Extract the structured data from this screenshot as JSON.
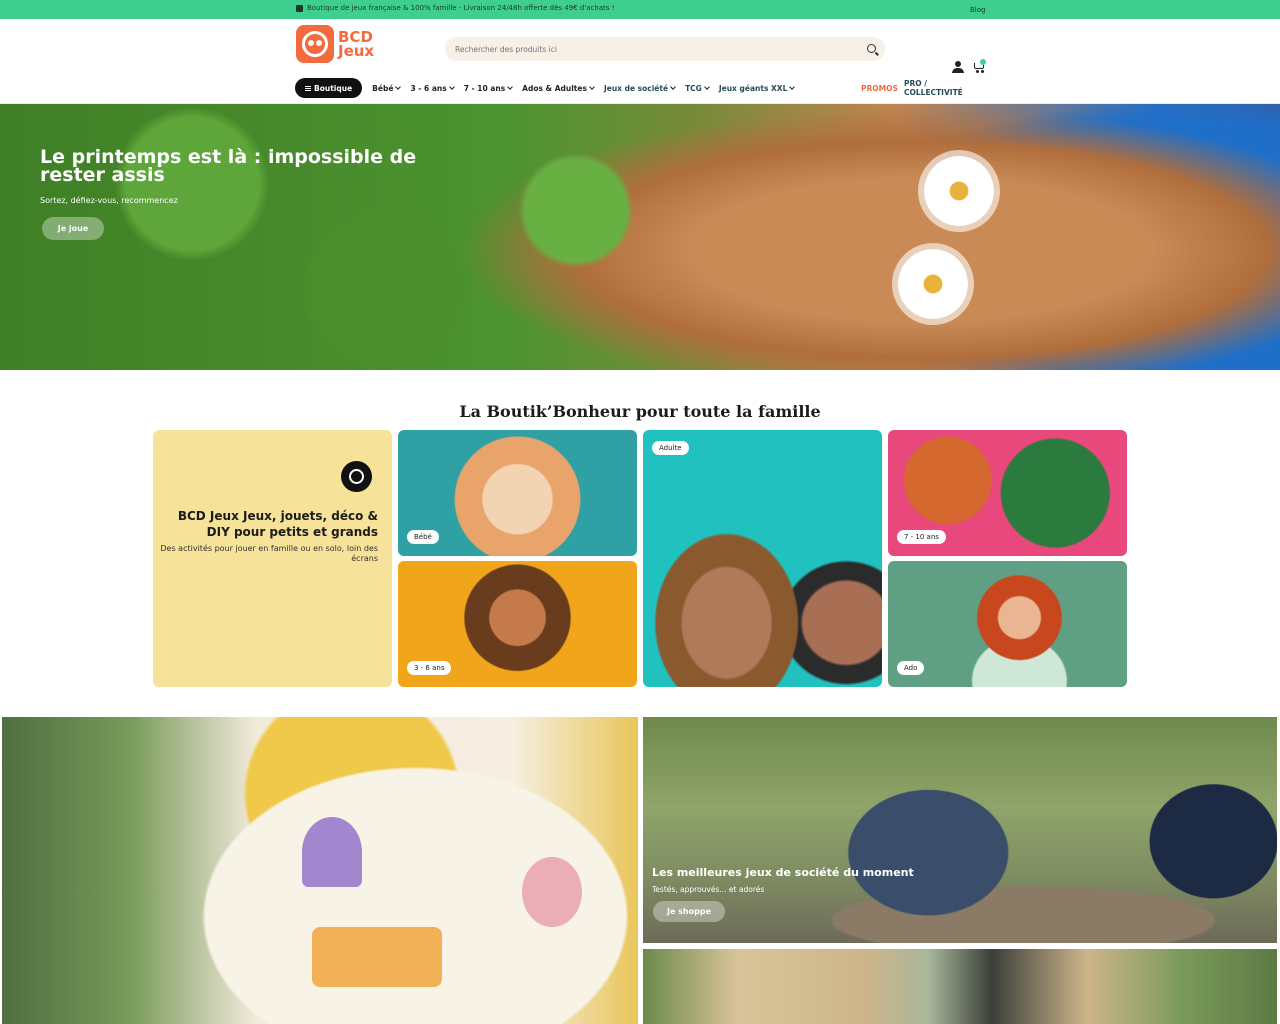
{
  "topbar": {
    "message": "Boutique de jeux française & 100% famille - Livraison 24/48h offerte dès 49€ d'achats !",
    "blog": "Blog"
  },
  "header": {
    "logo_line1": "BCD",
    "logo_line2": "Jeux",
    "search_placeholder": "Rechercher des produits ici"
  },
  "nav": {
    "boutique": "Boutique",
    "items": [
      "Bébé",
      "3 - 6 ans",
      "7 - 10 ans",
      "Ados & Adultes",
      "Jeux de société",
      "TCG",
      "Jeux géants XXL"
    ],
    "promos": "PROMOS",
    "pro": "PRO / COLLECTIVITÉ"
  },
  "hero": {
    "title": "Le printemps est là : impossible de rester assis",
    "subtitle": "Sortez, défiez-vous, recommencez",
    "cta": "Je joue"
  },
  "section": {
    "title": "La Boutik’Bonheur pour toute la famille"
  },
  "intro_card": {
    "title": "BCD Jeux Jeux, jouets, déco & DIY pour petits et grands",
    "subtitle": "Des activités pour jouer en famille ou en solo, loin des écrans"
  },
  "categories": {
    "bebe": "Bébé",
    "trois_six": "3 - 6 ans",
    "adulte": "Adulte",
    "sept_dix": "7 - 10 ans",
    "ado": "Ado"
  },
  "promo": {
    "title": "Les meilleures jeux de société du moment",
    "subtitle": "Testés, approuvés... et adorés",
    "cta": "Je shoppe"
  },
  "colors": {
    "accent_green": "#3ecf8e",
    "brand_orange": "#f26a3d",
    "intro_yellow": "#f7e29a"
  }
}
